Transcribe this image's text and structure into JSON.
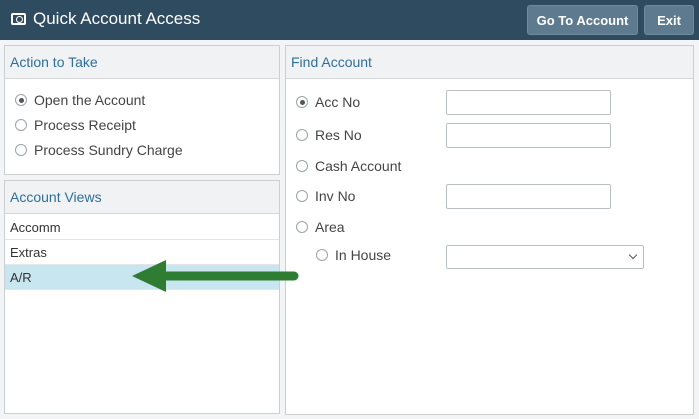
{
  "titlebar": {
    "icon": "account-card-icon",
    "title": "Quick Account Access",
    "go_to_account_label": "Go To Account",
    "exit_label": "Exit"
  },
  "action_panel": {
    "heading": "Action to Take",
    "options": [
      "Open the Account",
      "Process Receipt",
      "Process Sundry Charge"
    ],
    "selected": "Open the Account"
  },
  "views_panel": {
    "heading": "Account Views",
    "items": [
      "Accomm",
      "Extras",
      "A/R"
    ],
    "selected": "A/R"
  },
  "find_panel": {
    "heading": "Find Account",
    "acc_no_label": "Acc No",
    "acc_no_value": "",
    "res_no_label": "Res No",
    "res_no_value": "",
    "cash_account_label": "Cash Account",
    "inv_no_label": "Inv No",
    "inv_no_value": "",
    "area_label": "Area",
    "in_house_label": "In House",
    "area_select_value": "",
    "selected": "Acc No"
  },
  "colors": {
    "titlebar": "#2f4b5f",
    "button": "#5e7a8e",
    "heading_text": "#2f6f9a",
    "selected_row": "#c8e6f0",
    "arrow": "#2e7d32"
  }
}
